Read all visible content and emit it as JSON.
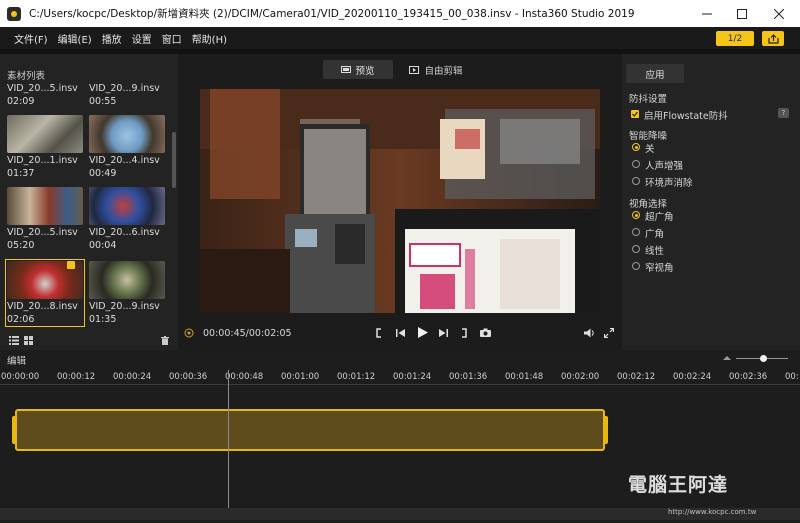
{
  "window": {
    "title": "C:/Users/kocpc/Desktop/新增資料夾 (2)/DCIM/Camera01/VID_20200110_193415_00_038.insv - Insta360 Studio 2019"
  },
  "menu": [
    "文件(F)",
    "编辑(E)",
    "播放",
    "设置",
    "窗口",
    "帮助(H)"
  ],
  "toolbar": {
    "page_indicator": "1/2"
  },
  "library": {
    "title": "素材列表",
    "clips": [
      {
        "name": "VID_20...5.insv",
        "duration": "02:09"
      },
      {
        "name": "VID_20...9.insv",
        "duration": "00:55"
      },
      {
        "name": "VID_20...1.insv",
        "duration": "01:37"
      },
      {
        "name": "VID_20...4.insv",
        "duration": "00:49"
      },
      {
        "name": "VID_20...5.insv",
        "duration": "05:20"
      },
      {
        "name": "VID_20...6.insv",
        "duration": "00:04"
      },
      {
        "name": "VID_20...8.insv",
        "duration": "02:06"
      },
      {
        "name": "VID_20...9.insv",
        "duration": "01:35"
      }
    ]
  },
  "viewer": {
    "tab_preview": "预览",
    "tab_free_edit": "自由剪辑",
    "time": "00:00:45/00:02:05"
  },
  "settings": {
    "apply_label": "应用",
    "stabilization_title": "防抖设置",
    "flowstate_label": "启用Flowstate防抖",
    "help_label": "?",
    "noise_title": "智能降噪",
    "noise_options": [
      "关",
      "人声增强",
      "环境声消除"
    ],
    "view_title": "视角选择",
    "view_options": [
      "超广角",
      "广角",
      "线性",
      "窄视角"
    ]
  },
  "timeline": {
    "title": "编辑",
    "ticks": [
      "00:00:00",
      "00:00:12",
      "00:00:24",
      "00:00:36",
      "00:00:48",
      "00:01:00",
      "00:01:12",
      "00:01:24",
      "00:01:36",
      "00:01:48",
      "00:02:00",
      "00:02:12",
      "00:02:24",
      "00:02:36",
      "00:02:48"
    ]
  },
  "watermark": {
    "text": "電腦王阿達",
    "url": "http://www.kocpc.com.tw"
  }
}
